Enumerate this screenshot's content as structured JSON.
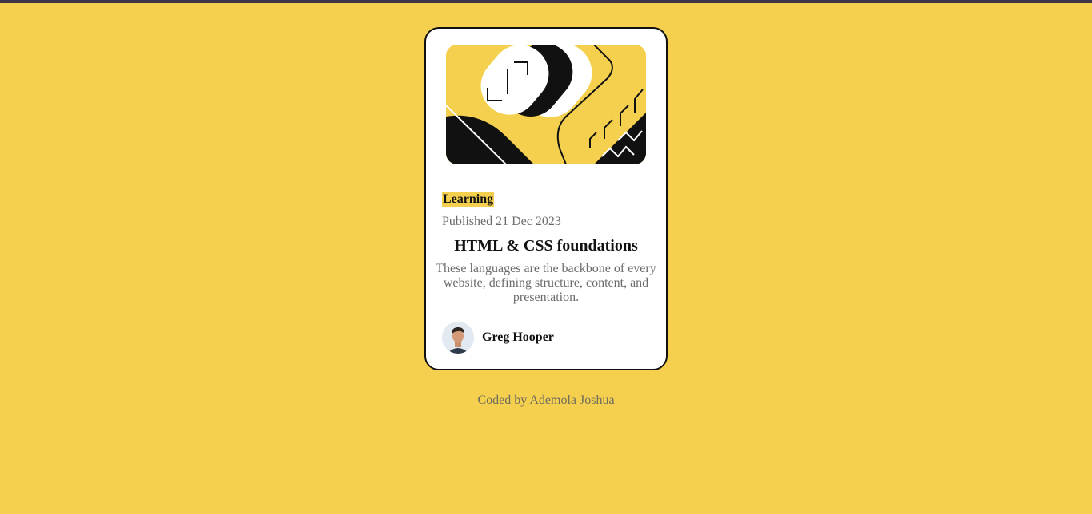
{
  "card": {
    "tag": "Learning",
    "published": "Published 21 Dec 2023",
    "title": "HTML & CSS foundations",
    "description": "These languages are the backbone of every website, defining structure, content, and presentation.",
    "author": {
      "name": "Greg Hooper",
      "avatar_icon": "person-avatar"
    },
    "hero_icon": "abstract-illustration"
  },
  "footer": {
    "credit": "Coded by Ademola Joshua"
  },
  "colors": {
    "background": "#f4d04e",
    "card": "#ffffff",
    "text": "#111111",
    "muted": "#6b6b6b",
    "topbar": "#3d3648"
  }
}
